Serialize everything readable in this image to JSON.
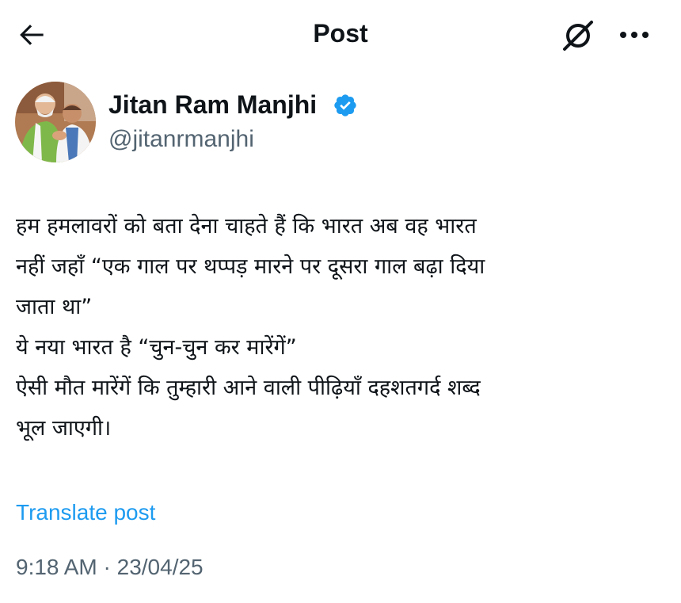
{
  "header": {
    "title": "Post",
    "back_icon": "arrow-left-icon",
    "grok_icon": "grok-icon",
    "more_icon": "more-horizontal-icon"
  },
  "author": {
    "display_name": "Jitan Ram Manjhi",
    "handle": "@jitanrmanjhi",
    "verified": true,
    "verified_color": "#1d9bf0"
  },
  "post": {
    "text": "हम हमलावरों को बता देना चाहते हैं कि भारत अब वह भारत\nनहीं जहाँ “एक गाल पर थप्पड़ मारने पर दूसरा गाल बढ़ा दिया\nजाता था”\nये नया भारत है “चुन-चुन कर मारेंगें”\nऐसी मौत मारेंगें कि तुम्हारी आने वाली पीढ़ियाँ दहशतगर्द शब्द\nभूल जाएगी।",
    "translate_label": "Translate post",
    "time": "9:18 AM",
    "separator": "·",
    "date": "23/04/25"
  },
  "colors": {
    "accent": "#1d9bf0",
    "secondary_text": "#536471",
    "primary_text": "#0f1419"
  }
}
